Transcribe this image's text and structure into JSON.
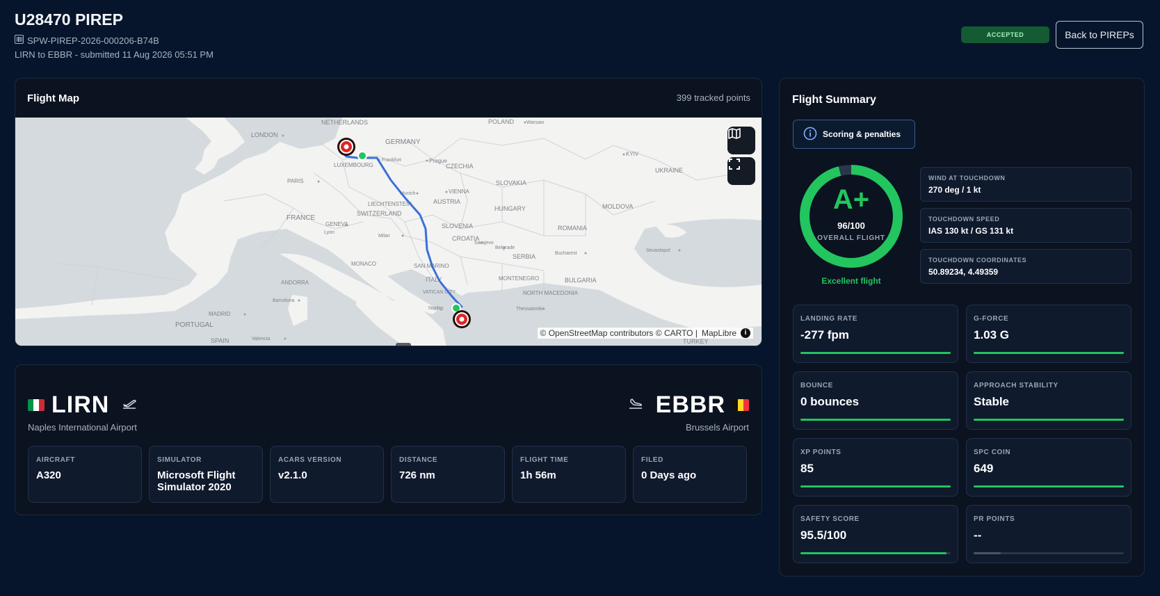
{
  "header": {
    "title": "U28470 PIREP",
    "ref": "SPW-PIREP-2026-000206-B74B",
    "subtitle": "LIRN to EBBR - submitted 11 Aug 2026 05:51 PM",
    "status": "ACCEPTED",
    "back_label": "Back to PIREPs"
  },
  "map": {
    "title": "Flight Map",
    "points_label": "399 tracked points",
    "attribution_prefix": "© OpenStreetMap contributors © CARTO |",
    "attribution_link": "MapLibre",
    "labels": [
      "NETHERLANDS",
      "POLAND",
      "Warsaw",
      "LONDON",
      "GERMANY",
      "Frankfurt",
      "Prague",
      "CZECHIA",
      "KYIV",
      "LUXEMBOURG",
      "UKRAINE",
      "PARIS",
      "SLOVAKIA",
      "Munich",
      "VIENNA",
      "AUSTRIA",
      "LIECHTENSTEIN",
      "HUNGARY",
      "SWITZERLAND",
      "MOLDOVA",
      "FRANCE",
      "GENEVA",
      "SLOVENIA",
      "ROMANIA",
      "Lyon",
      "Milan",
      "CROATIA",
      "Belgrade",
      "Bucharest",
      "Sarajevo",
      "SERBIA",
      "Sevastopol",
      "MONACO",
      "SAN MARINO",
      "MONTENEGRO",
      "BULGARIA",
      "ANDORRA",
      "ITALY",
      "VATICAN CITY",
      "Barcelona",
      "NORTH MACEDONIA",
      "Naples",
      "Thessaloniki",
      "MADRID",
      "PORTUGAL",
      "SPAIN",
      "Valencia",
      "TURKEY"
    ]
  },
  "route": {
    "origin": {
      "code": "LIRN",
      "name": "Naples International Airport",
      "flag": [
        "#009246",
        "#ffffff",
        "#ce2b37"
      ]
    },
    "destination": {
      "code": "EBBR",
      "name": "Brussels Airport",
      "flag": [
        "#111111",
        "#fdda24",
        "#ef3340"
      ]
    },
    "stats": [
      {
        "label": "AIRCRAFT",
        "value": "A320"
      },
      {
        "label": "SIMULATOR",
        "value": "Microsoft Flight Simulator 2020"
      },
      {
        "label": "ACARS VERSION",
        "value": "v2.1.0"
      },
      {
        "label": "DISTANCE",
        "value": "726 nm"
      },
      {
        "label": "FLIGHT TIME",
        "value": "1h 56m"
      },
      {
        "label": "FILED",
        "value": "0 Days ago"
      }
    ]
  },
  "summary": {
    "title": "Flight Summary",
    "scoring_label": "Scoring & penalties",
    "grade": "A+",
    "score_text": "96/100",
    "score_fraction": 0.96,
    "score_label": "OVERALL FLIGHT",
    "grade_desc": "Excellent flight",
    "touchdown": [
      {
        "label": "WIND AT TOUCHDOWN",
        "value": "270 deg / 1 kt"
      },
      {
        "label": "TOUCHDOWN SPEED",
        "value": "IAS 130 kt / GS 131 kt"
      },
      {
        "label": "TOUCHDOWN COORDINATES",
        "value": "50.89234, 4.49359"
      }
    ],
    "metrics": [
      {
        "label": "LANDING RATE",
        "value": "-277 fpm",
        "level": 1.0
      },
      {
        "label": "G-FORCE",
        "value": "1.03 G",
        "level": 1.0
      },
      {
        "label": "BOUNCE",
        "value": "0 bounces",
        "level": 1.0
      },
      {
        "label": "APPROACH STABILITY",
        "value": "Stable",
        "level": 1.0
      },
      {
        "label": "XP POINTS",
        "value": "85",
        "level": 1.0
      },
      {
        "label": "SPC COIN",
        "value": "649",
        "level": 1.0
      },
      {
        "label": "SAFETY SCORE",
        "value": "95.5/100",
        "level": 0.97
      },
      {
        "label": "PR POINTS",
        "value": "--",
        "level": 0.18
      }
    ],
    "colors": {
      "accent_green": "#22c55e",
      "track_empty": "#2a364a",
      "pr_fill": "#4b5567"
    }
  }
}
